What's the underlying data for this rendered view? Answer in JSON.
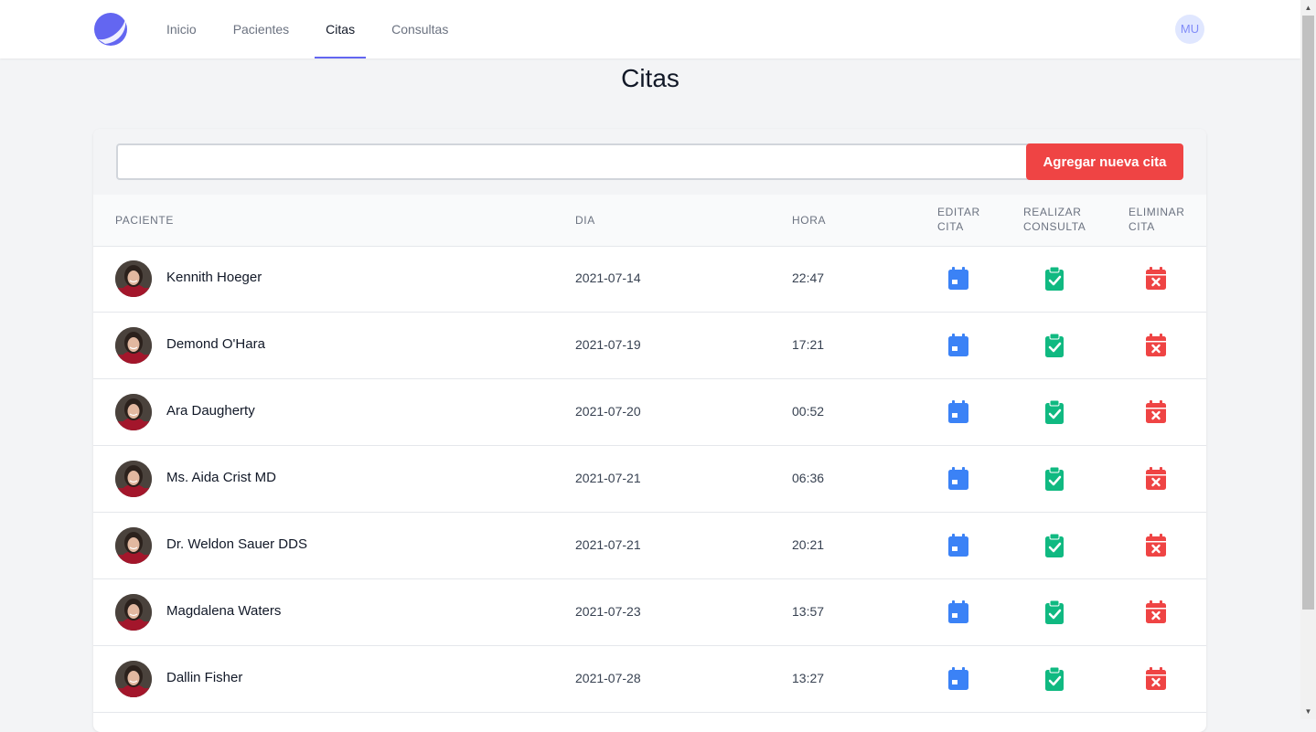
{
  "nav": {
    "items": [
      {
        "label": "Inicio",
        "active": false
      },
      {
        "label": "Pacientes",
        "active": false
      },
      {
        "label": "Citas",
        "active": true
      },
      {
        "label": "Consultas",
        "active": false
      }
    ],
    "user_initials": "MU"
  },
  "page": {
    "title": "Citas"
  },
  "search": {
    "value": "",
    "placeholder": ""
  },
  "toolbar": {
    "add_label": "Agregar nueva cita"
  },
  "table": {
    "headers": {
      "patient": "PACIENTE",
      "day": "DIA",
      "hour": "HORA",
      "edit": [
        "EDITAR",
        "CITA"
      ],
      "consult": [
        "REALIZAR",
        "CONSULTA"
      ],
      "delete": [
        "ELIMINAR",
        "CITA"
      ]
    },
    "rows": [
      {
        "name": "Kennith Hoeger",
        "day": "2021-07-14",
        "hour": "22:47"
      },
      {
        "name": "Demond O'Hara",
        "day": "2021-07-19",
        "hour": "17:21"
      },
      {
        "name": "Ara Daugherty",
        "day": "2021-07-20",
        "hour": "00:52"
      },
      {
        "name": "Ms. Aida Crist MD",
        "day": "2021-07-21",
        "hour": "06:36"
      },
      {
        "name": "Dr. Weldon Sauer DDS",
        "day": "2021-07-21",
        "hour": "20:21"
      },
      {
        "name": "Magdalena Waters",
        "day": "2021-07-23",
        "hour": "13:57"
      },
      {
        "name": "Dallin Fisher",
        "day": "2021-07-28",
        "hour": "13:27"
      }
    ]
  },
  "colors": {
    "accent": "#6366f1",
    "edit_icon": "#3b82f6",
    "consult_icon": "#10b981",
    "delete_icon": "#ef4444",
    "add_button": "#ef4444"
  },
  "icons": {
    "logo": "moon-logo-icon",
    "edit": "calendar-icon",
    "consult": "clipboard-check-icon",
    "delete": "calendar-x-icon"
  }
}
